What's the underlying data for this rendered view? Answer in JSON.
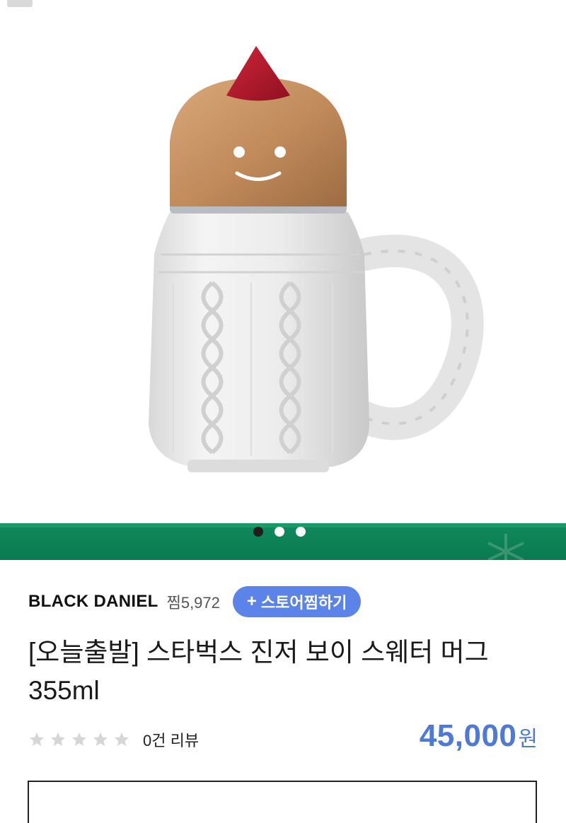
{
  "product_image": {
    "alt": "gingerbread boy sweater mug",
    "carousel": {
      "total": 3,
      "active_index": 0
    }
  },
  "store": {
    "name": "BLACK DANIEL",
    "zzim_label": "찜5,972",
    "follow_label": "스토어찜하기",
    "follow_icon": "plus-icon"
  },
  "product": {
    "title": "[오늘출발] 스타벅스 진저 보이 스웨터 머그 355ml",
    "rating": 0,
    "max_rating": 5,
    "review_label": "0건 리뷰",
    "price": "45,000",
    "currency": "원"
  },
  "colors": {
    "accent": "#5b83e8",
    "price": "#4e79d6",
    "banner": "#0f8a5c",
    "star_empty": "#d6d6d6"
  }
}
